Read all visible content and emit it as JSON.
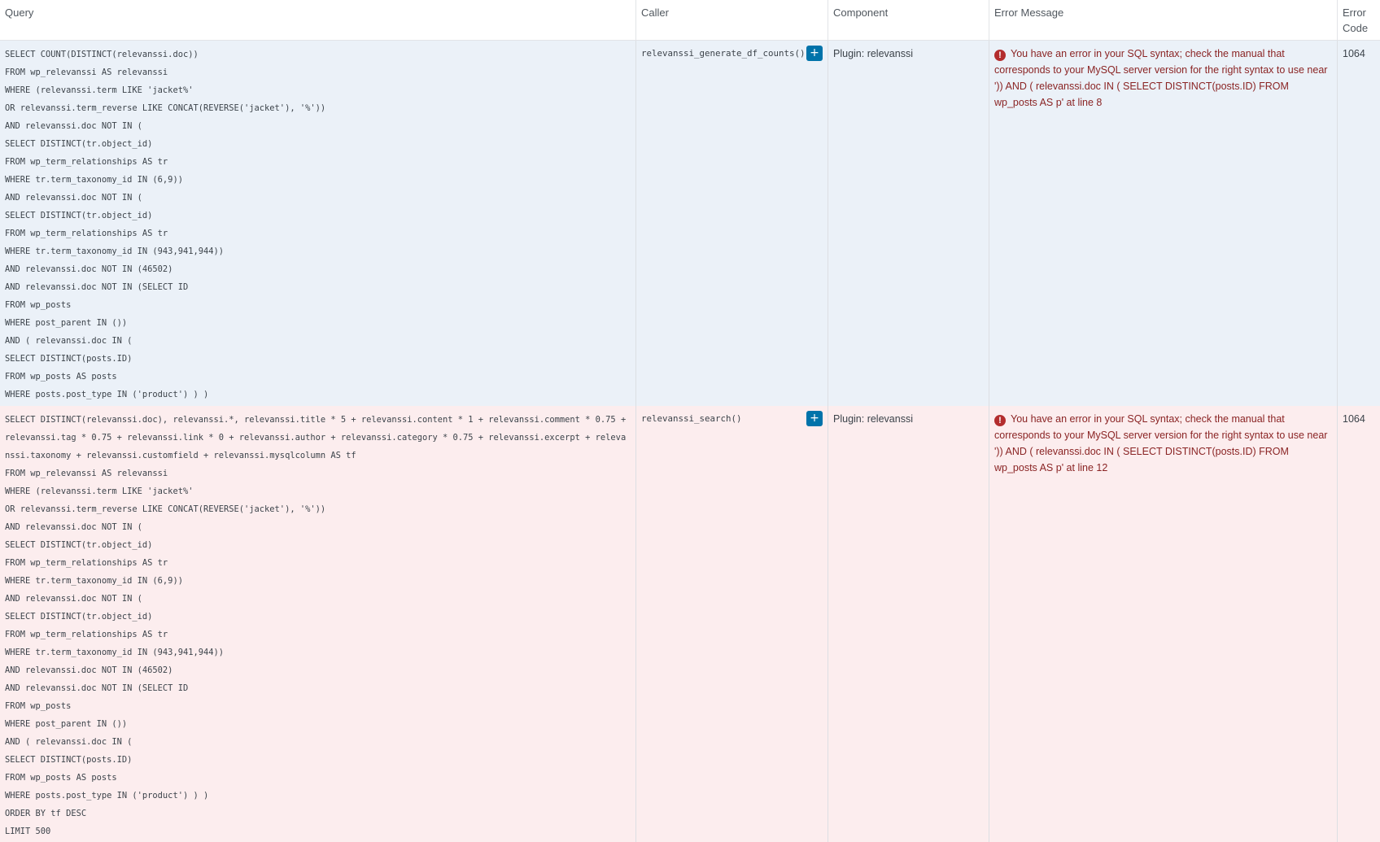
{
  "columns": [
    "Query",
    "Caller",
    "Component",
    "Error Message",
    "Error Code"
  ],
  "rows": [
    {
      "query_lines": [
        "SELECT COUNT(DISTINCT(relevanssi.doc))",
        "FROM wp_relevanssi AS relevanssi",
        "WHERE (relevanssi.term LIKE 'jacket%'",
        "OR relevanssi.term_reverse LIKE CONCAT(REVERSE('jacket'), '%'))",
        "AND relevanssi.doc NOT IN (",
        "SELECT DISTINCT(tr.object_id)",
        "FROM wp_term_relationships AS tr",
        "WHERE tr.term_taxonomy_id IN (6,9))",
        "AND relevanssi.doc NOT IN (",
        "SELECT DISTINCT(tr.object_id)",
        "FROM wp_term_relationships AS tr",
        "WHERE tr.term_taxonomy_id IN (943,941,944))",
        "AND relevanssi.doc NOT IN (46502)",
        "AND relevanssi.doc NOT IN (SELECT ID",
        "FROM wp_posts",
        "WHERE post_parent IN ())",
        "AND ( relevanssi.doc IN (",
        "SELECT DISTINCT(posts.ID)",
        "FROM wp_posts AS posts",
        "WHERE posts.post_type IN ('product') ) )"
      ],
      "caller": "relevanssi_generate_df_counts()",
      "expand_label": "+",
      "component": "Plugin: relevanssi",
      "error_message": "You have an error in your SQL syntax; check the manual that corresponds to your MySQL server version for the right syntax to use near ')) AND ( relevanssi.doc IN ( SELECT DISTINCT(posts.ID) FROM wp_posts AS p' at line 8",
      "error_code": "1064"
    },
    {
      "query_first": "SELECT DISTINCT(relevanssi.doc), relevanssi.*, relevanssi.title * 5 + relevanssi.content * 1 + relevanssi.comment * 0.75 + relevanssi.tag * 0.75 + relevanssi.link * 0 + relevanssi.author + relevanssi.category * 0.75 + relevanssi.excerpt + relevanssi.taxonomy + relevanssi.customfield + relevanssi.mysqlcolumn AS tf",
      "query_lines": [
        "FROM wp_relevanssi AS relevanssi",
        "WHERE (relevanssi.term LIKE 'jacket%'",
        "OR relevanssi.term_reverse LIKE CONCAT(REVERSE('jacket'), '%'))",
        "AND relevanssi.doc NOT IN (",
        "SELECT DISTINCT(tr.object_id)",
        "FROM wp_term_relationships AS tr",
        "WHERE tr.term_taxonomy_id IN (6,9))",
        "AND relevanssi.doc NOT IN (",
        "SELECT DISTINCT(tr.object_id)",
        "FROM wp_term_relationships AS tr",
        "WHERE tr.term_taxonomy_id IN (943,941,944))",
        "AND relevanssi.doc NOT IN (46502)",
        "AND relevanssi.doc NOT IN (SELECT ID",
        "FROM wp_posts",
        "WHERE post_parent IN ())",
        "AND ( relevanssi.doc IN (",
        "SELECT DISTINCT(posts.ID)",
        "FROM wp_posts AS posts",
        "WHERE posts.post_type IN ('product') ) )",
        "ORDER BY tf DESC",
        "LIMIT 500"
      ],
      "caller": "relevanssi_search()",
      "expand_label": "+",
      "component": "Plugin: relevanssi",
      "error_message": "You have an error in your SQL syntax; check the manual that corresponds to your MySQL server version for the right syntax to use near ')) AND ( relevanssi.doc IN ( SELECT DISTINCT(posts.ID) FROM wp_posts AS p' at line 12",
      "error_code": "1064"
    }
  ],
  "icons": {
    "error": "exclamation-circle-icon",
    "expand": "plus-icon"
  },
  "colors": {
    "row1_bg": "#ebf1f8",
    "row2_bg": "#fcedee",
    "error_text": "#8a2424",
    "button_bg": "#0073aa"
  }
}
